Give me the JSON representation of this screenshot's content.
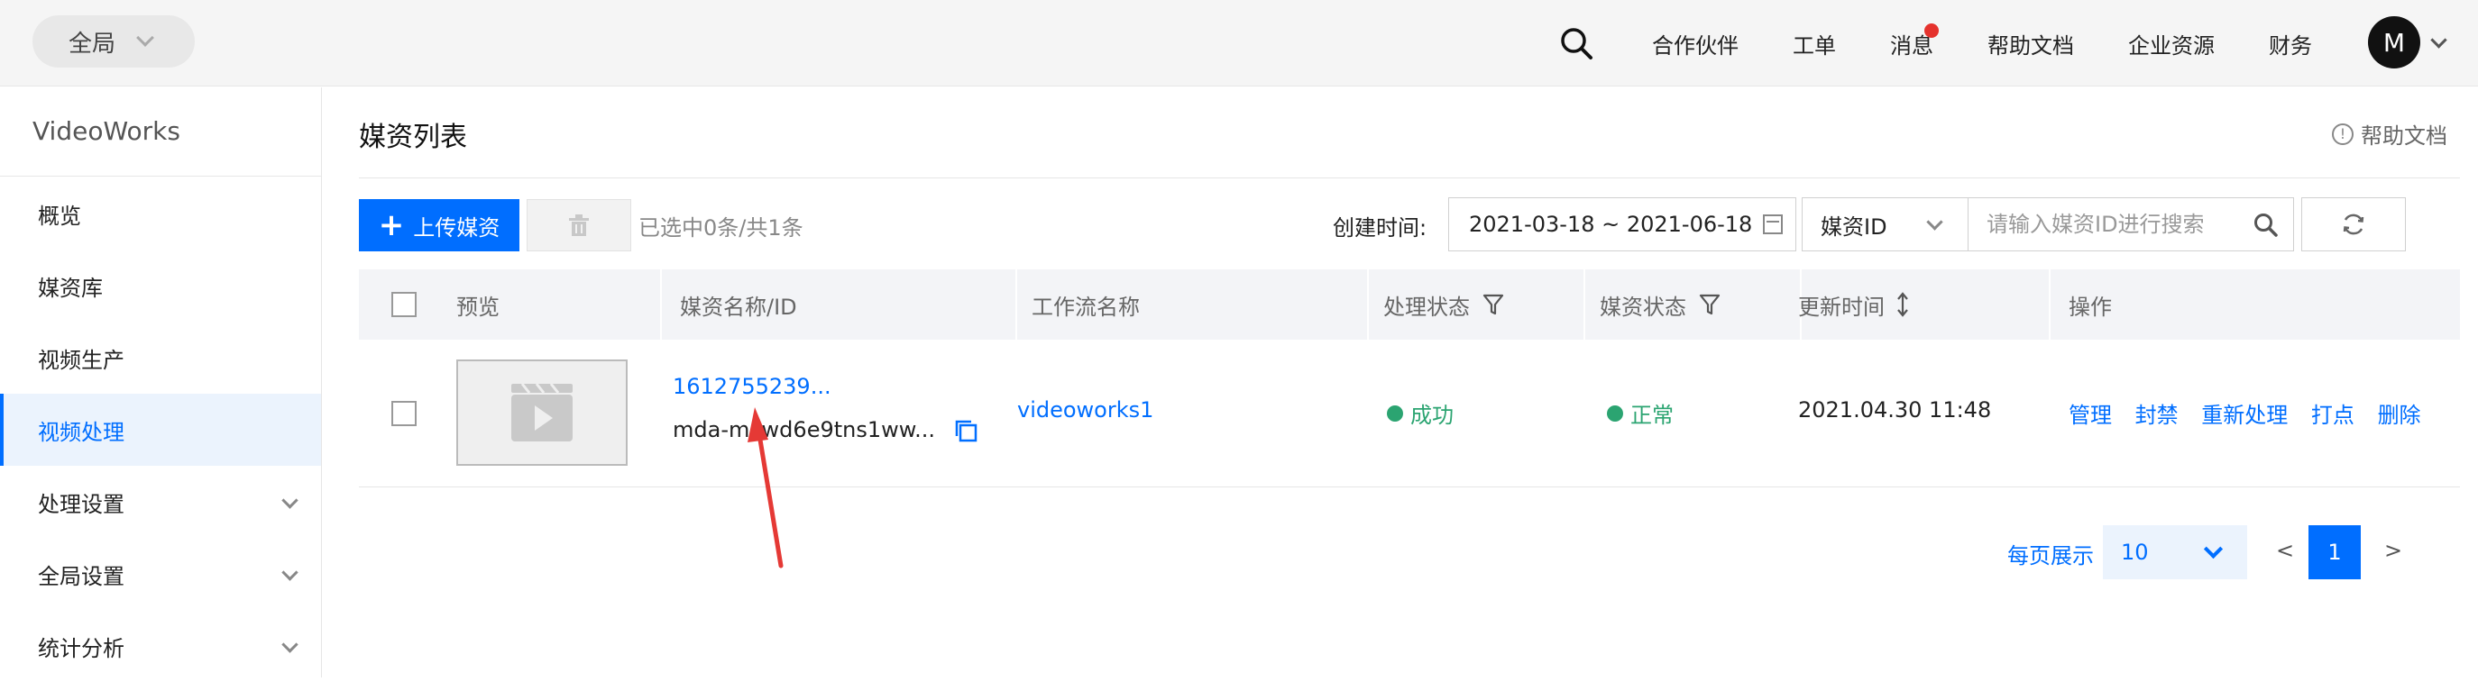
{
  "topbar": {
    "scope_label": "全局",
    "nav": [
      "合作伙伴",
      "工单",
      "消息",
      "帮助文档",
      "企业资源",
      "财务"
    ],
    "avatar_initial": "M"
  },
  "sidebar": {
    "brand": "VideoWorks",
    "items": [
      {
        "label": "概览"
      },
      {
        "label": "媒资库"
      },
      {
        "label": "视频生产"
      },
      {
        "label": "视频处理",
        "active": true
      },
      {
        "label": "处理设置",
        "expandable": true
      },
      {
        "label": "全局设置",
        "expandable": true
      },
      {
        "label": "统计分析",
        "expandable": true
      }
    ]
  },
  "page": {
    "title": "媒资列表",
    "help_link": "帮助文档"
  },
  "toolbar": {
    "upload_label": "上传媒资",
    "selection_info": "已选中0条/共1条",
    "create_time_label": "创建时间:",
    "date_range": "2021-03-18 ~ 2021-06-18",
    "search_type": "媒资ID",
    "search_placeholder": "请输入媒资ID进行搜索"
  },
  "table": {
    "headers": {
      "preview": "预览",
      "name": "媒资名称/ID",
      "workflow": "工作流名称",
      "process_status": "处理状态",
      "media_status": "媒资状态",
      "updated": "更新时间",
      "actions": "操作"
    },
    "rows": [
      {
        "name": "1612755239...",
        "id": "mda-mcwd6e9tns1ww...",
        "workflow": "videoworks1",
        "process_status": "成功",
        "media_status": "正常",
        "updated": "2021.04.30 11:48",
        "actions": [
          "管理",
          "封禁",
          "重新处理",
          "打点",
          "删除"
        ]
      }
    ]
  },
  "pagination": {
    "per_page_label": "每页展示",
    "per_page_value": "10",
    "prev": "<",
    "current_page": "1",
    "next": ">"
  },
  "colors": {
    "accent": "#006eff",
    "success": "#2ba471",
    "annotation_arrow": "#e53935"
  }
}
